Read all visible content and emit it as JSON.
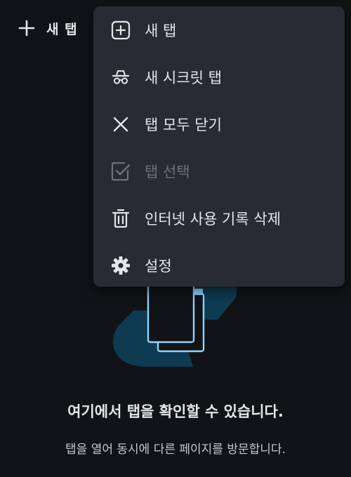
{
  "toolbar": {
    "new_tab_label": "새 탭"
  },
  "menu": {
    "items": [
      {
        "label": "새 탭",
        "icon": "add-box-icon",
        "enabled": true
      },
      {
        "label": "새 시크릿 탭",
        "icon": "incognito-icon",
        "enabled": true
      },
      {
        "label": "탭 모두 닫기",
        "icon": "close-icon",
        "enabled": true
      },
      {
        "label": "탭 선택",
        "icon": "checkbox-icon",
        "enabled": false
      },
      {
        "label": "인터넷 사용 기록 삭제",
        "icon": "trash-icon",
        "enabled": true
      },
      {
        "label": "설정",
        "icon": "gear-icon",
        "enabled": true
      }
    ]
  },
  "empty_state": {
    "title": "여기에서 탭을 확인할 수 있습니다.",
    "subtitle": "탭을 열어 동시에 다른 페이지를 방문합니다."
  },
  "colors": {
    "background": "#121316",
    "menu_background": "#282a34",
    "accent": "#8fd3ff",
    "illustration_blob": "#0e3b52",
    "disabled_text": "#6f717a"
  }
}
